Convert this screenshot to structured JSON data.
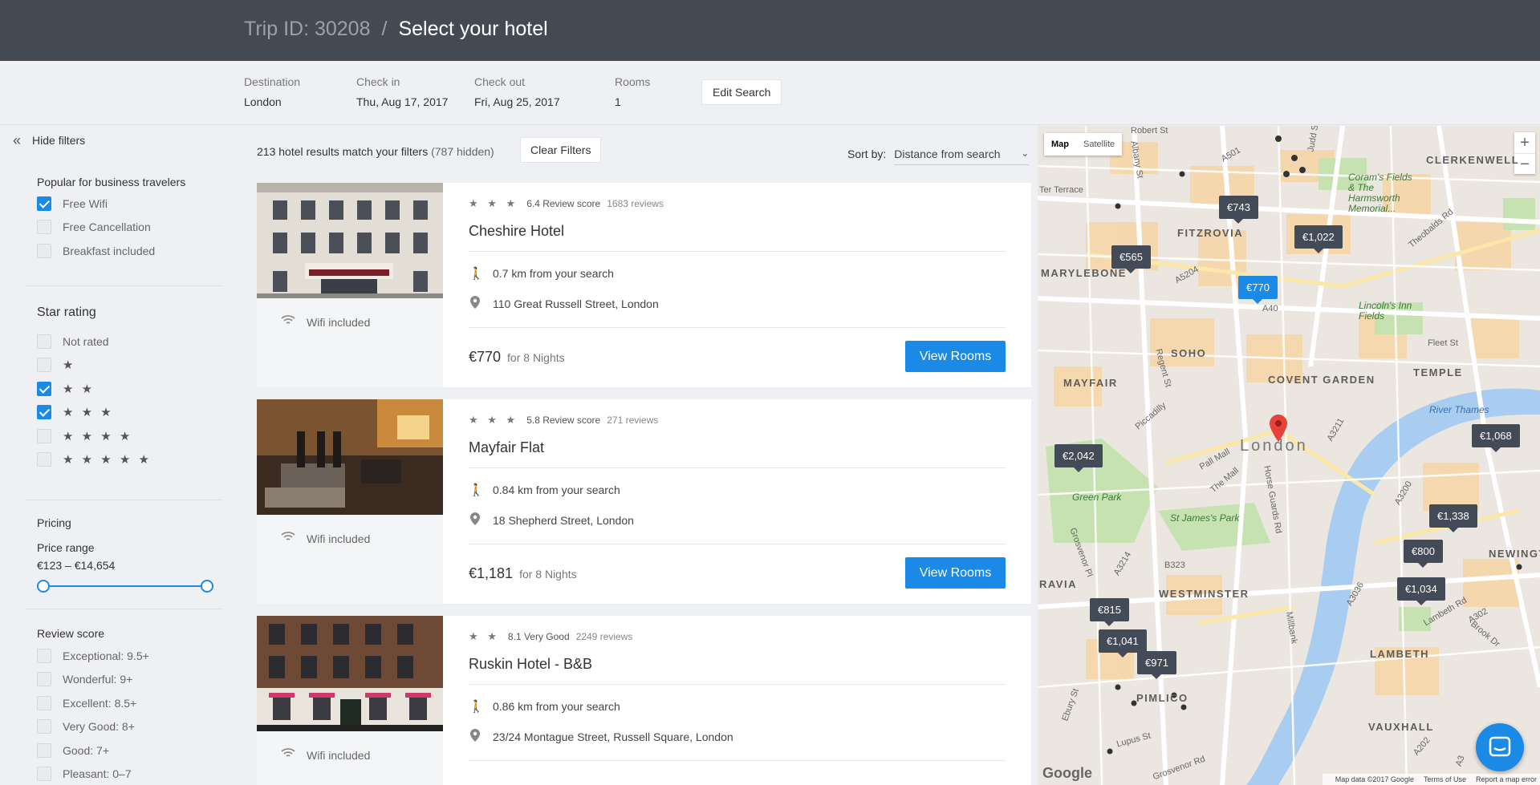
{
  "header": {
    "trip_id": "Trip ID: 30208",
    "separator": "/",
    "title": "Select your hotel"
  },
  "search": {
    "destination_label": "Destination",
    "destination": "London",
    "checkin_label": "Check in",
    "checkin": "Thu, Aug 17, 2017",
    "checkout_label": "Check out",
    "checkout": "Fri, Aug 25, 2017",
    "rooms_label": "Rooms",
    "rooms": "1",
    "edit_label": "Edit Search"
  },
  "filters": {
    "hide_label": "Hide filters",
    "popular_title": "Popular for business travelers",
    "popular": [
      {
        "label": "Free Wifi",
        "checked": true
      },
      {
        "label": "Free Cancellation",
        "checked": false
      },
      {
        "label": "Breakfast included",
        "checked": false
      }
    ],
    "star_title": "Star rating",
    "stars": [
      {
        "label": "Not rated",
        "checked": false
      },
      {
        "label": "★",
        "checked": false
      },
      {
        "label": "★ ★",
        "checked": true
      },
      {
        "label": "★ ★ ★",
        "checked": true
      },
      {
        "label": "★ ★ ★ ★",
        "checked": false
      },
      {
        "label": "★ ★ ★ ★ ★",
        "checked": false
      }
    ],
    "pricing_title": "Pricing",
    "price_range_label": "Price range",
    "price_range": "€123 – €14,654",
    "review_title": "Review score",
    "reviews": [
      {
        "label": "Exceptional: 9.5+",
        "checked": false
      },
      {
        "label": "Wonderful: 9+",
        "checked": false
      },
      {
        "label": "Excellent: 8.5+",
        "checked": false
      },
      {
        "label": "Very Good: 8+",
        "checked": false
      },
      {
        "label": "Good: 7+",
        "checked": false
      },
      {
        "label": "Pleasant: 0–7",
        "checked": false
      }
    ]
  },
  "results": {
    "count_text": "213 hotel results match your filters",
    "hidden_text": "(787 hidden)",
    "clear_label": "Clear Filters",
    "sort_label": "Sort by:",
    "sort_value": "Distance from search",
    "hotels": [
      {
        "stars": "★ ★ ★",
        "score": "6.4 Review score",
        "reviews": "1683 reviews",
        "name": "Cheshire Hotel",
        "distance": "0.7 km from your search",
        "address": "110 Great Russell Street, London",
        "price": "€770",
        "nights": "for 8 Nights",
        "wifi": "Wifi included",
        "button": "View Rooms"
      },
      {
        "stars": "★ ★ ★",
        "score": "5.8 Review score",
        "reviews": "271 reviews",
        "name": "Mayfair Flat",
        "distance": "0.84 km from your search",
        "address": "18 Shepherd Street, London",
        "price": "€1,181",
        "nights": "for 8 Nights",
        "wifi": "Wifi included",
        "button": "View Rooms"
      },
      {
        "stars": "★ ★",
        "score": "8.1 Very Good",
        "reviews": "2249 reviews",
        "name": "Ruskin Hotel - B&B",
        "distance": "0.86 km from your search",
        "address": "23/24 Montague Street, Russell Square, London",
        "price": "",
        "nights": "",
        "wifi": "Wifi included",
        "button": ""
      }
    ]
  },
  "map": {
    "type_map": "Map",
    "type_satellite": "Satellite",
    "zoom_in": "+",
    "zoom_out": "−",
    "areas": [
      "FITZROVIA",
      "MARYLEBONE",
      "SOHO",
      "MAYFAIR",
      "COVENT GARDEN",
      "TEMPLE",
      "CLERKENWELL",
      "WESTMINSTER",
      "LAMBETH",
      "VAUXHALL",
      "NEWINGTON",
      "PIMLICO",
      "RAVIA"
    ],
    "greens": [
      "Green Park",
      "St James's Park",
      "Coram's Fields & The Harmsworth Memorial...",
      "Lincoln's Inn Fields"
    ],
    "water": "River Thames",
    "city": "London",
    "streets": [
      "Robert St",
      "Albany St",
      "A501",
      "Judd St",
      "Ter Terrace",
      "Theobalds Rd",
      "A5204",
      "A40",
      "Regent St",
      "Piccadilly",
      "Pall Mall",
      "The Mall",
      "Fleet St",
      "A3211",
      "A3200",
      "A3036",
      "A3214",
      "B323",
      "Grosvenor Pl",
      "Lupus St",
      "Grosvenor Rd",
      "Lambeth Rd",
      "Brook Dr",
      "A302",
      "A202",
      "A3",
      "Millbank",
      "Ebury St",
      "Horse Guards Rd"
    ],
    "prices": [
      {
        "label": "€743",
        "selected": false
      },
      {
        "label": "€1,022",
        "selected": false
      },
      {
        "label": "€565",
        "selected": false
      },
      {
        "label": "€770",
        "selected": true
      },
      {
        "label": "€1,068",
        "selected": false
      },
      {
        "label": "€2,042",
        "selected": false
      },
      {
        "label": "€1,338",
        "selected": false
      },
      {
        "label": "€800",
        "selected": false
      },
      {
        "label": "€1,034",
        "selected": false
      },
      {
        "label": "€815",
        "selected": false
      },
      {
        "label": "€1,041",
        "selected": false
      },
      {
        "label": "€971",
        "selected": false
      }
    ],
    "google": "Google",
    "attrib_data": "Map data ©2017 Google",
    "attrib_terms": "Terms of Use",
    "attrib_report": "Report a map error"
  }
}
